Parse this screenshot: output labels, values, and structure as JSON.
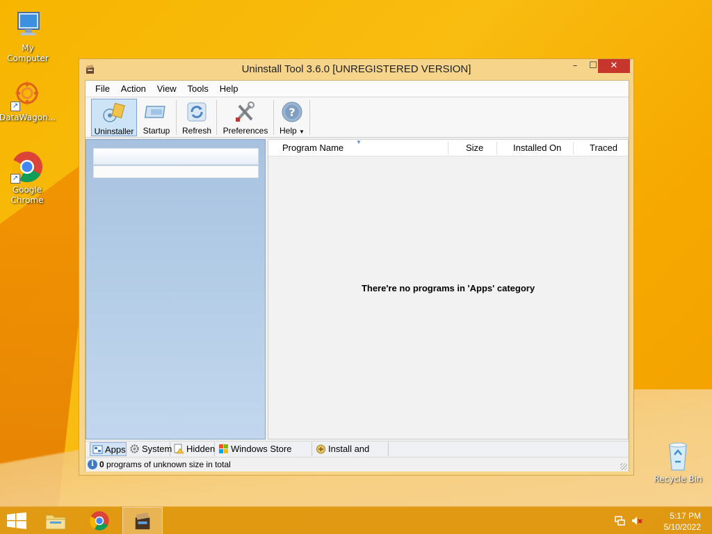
{
  "desktop": {
    "icons": [
      {
        "label": "My Computer"
      },
      {
        "label": "DataWagon..."
      },
      {
        "label": "Google Chrome"
      },
      {
        "label": "Recycle Bin"
      }
    ]
  },
  "window": {
    "title": "Uninstall Tool 3.6.0 [UNREGISTERED VERSION]",
    "controls": {
      "minimize": "–",
      "maximize": "☐",
      "close": "✕"
    },
    "menu": [
      "File",
      "Action",
      "View",
      "Tools",
      "Help"
    ],
    "toolbar": {
      "uninstaller": "Uninstaller",
      "startup": "Startup",
      "refresh": "Refresh",
      "preferences": "Preferences",
      "help": "Help"
    },
    "list": {
      "columns": [
        "Program Name",
        "Size",
        "Installed On",
        "Traced"
      ],
      "empty_message": "There're no programs in 'Apps' category"
    },
    "tabs": [
      "Apps",
      "System",
      "Hidden",
      "Windows Store Apps",
      "Install and trace"
    ],
    "active_tab": "Apps",
    "status": {
      "count": "0",
      "text": " programs of unknown size in total"
    }
  },
  "taskbar": {
    "time": "5:17 PM",
    "date": "5/10/2022"
  },
  "colors": {
    "close_button": "#c7362c",
    "active_selection": "#cde4f7",
    "left_pane": "#b7cfe8"
  }
}
